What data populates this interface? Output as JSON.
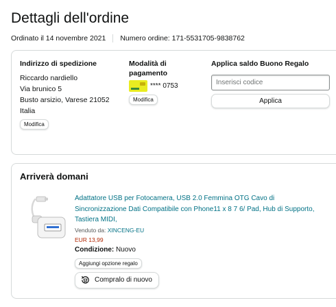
{
  "page": {
    "title": "Dettagli dell'ordine",
    "ordered_on": "Ordinato il 14 novembre 2021",
    "order_number": "Numero ordine: 171-5531705-9838762"
  },
  "shipping": {
    "title": "Indirizzo di spedizione",
    "lines": [
      "Riccardo nardiello",
      "Via brunico 5",
      "Busto arsizio, Varese 21052",
      "Italia"
    ],
    "edit_label": "Modifica"
  },
  "payment": {
    "title_line1": "Modalità di",
    "title_line2": "pagamento",
    "card_masked": "**** 0753",
    "edit_label": "Modifica",
    "card_color": "#e9ec21"
  },
  "gift": {
    "title": "Applica saldo Buono Regalo",
    "placeholder": "Inserisci codice",
    "apply_label": "Applica"
  },
  "shipment": {
    "title": "Arriverà domani",
    "product": {
      "title": "Adattatore USB per Fotocamera, USB 2.0 Femmina OTG Cavo di Sincronizzazione Dati Compatibile con Phone11 x 8 7 6/ Pad, Hub di Supporto, Tastiera MIDI,",
      "sold_by_label": "Venduto da:",
      "seller": "XINCENG-EU",
      "price": "EUR 13,99",
      "condition_label": "Condizione:",
      "condition_value": "Nuovo",
      "gift_option_label": "Aggiungi opzione regalo",
      "buy_again_label": "Compralo di nuovo",
      "icons": {
        "buy_again": "reorder-icon",
        "product": "usb-adapter-image"
      }
    }
  },
  "colors": {
    "link": "#007185",
    "price": "#b12704",
    "border": "#d5d9d9"
  }
}
